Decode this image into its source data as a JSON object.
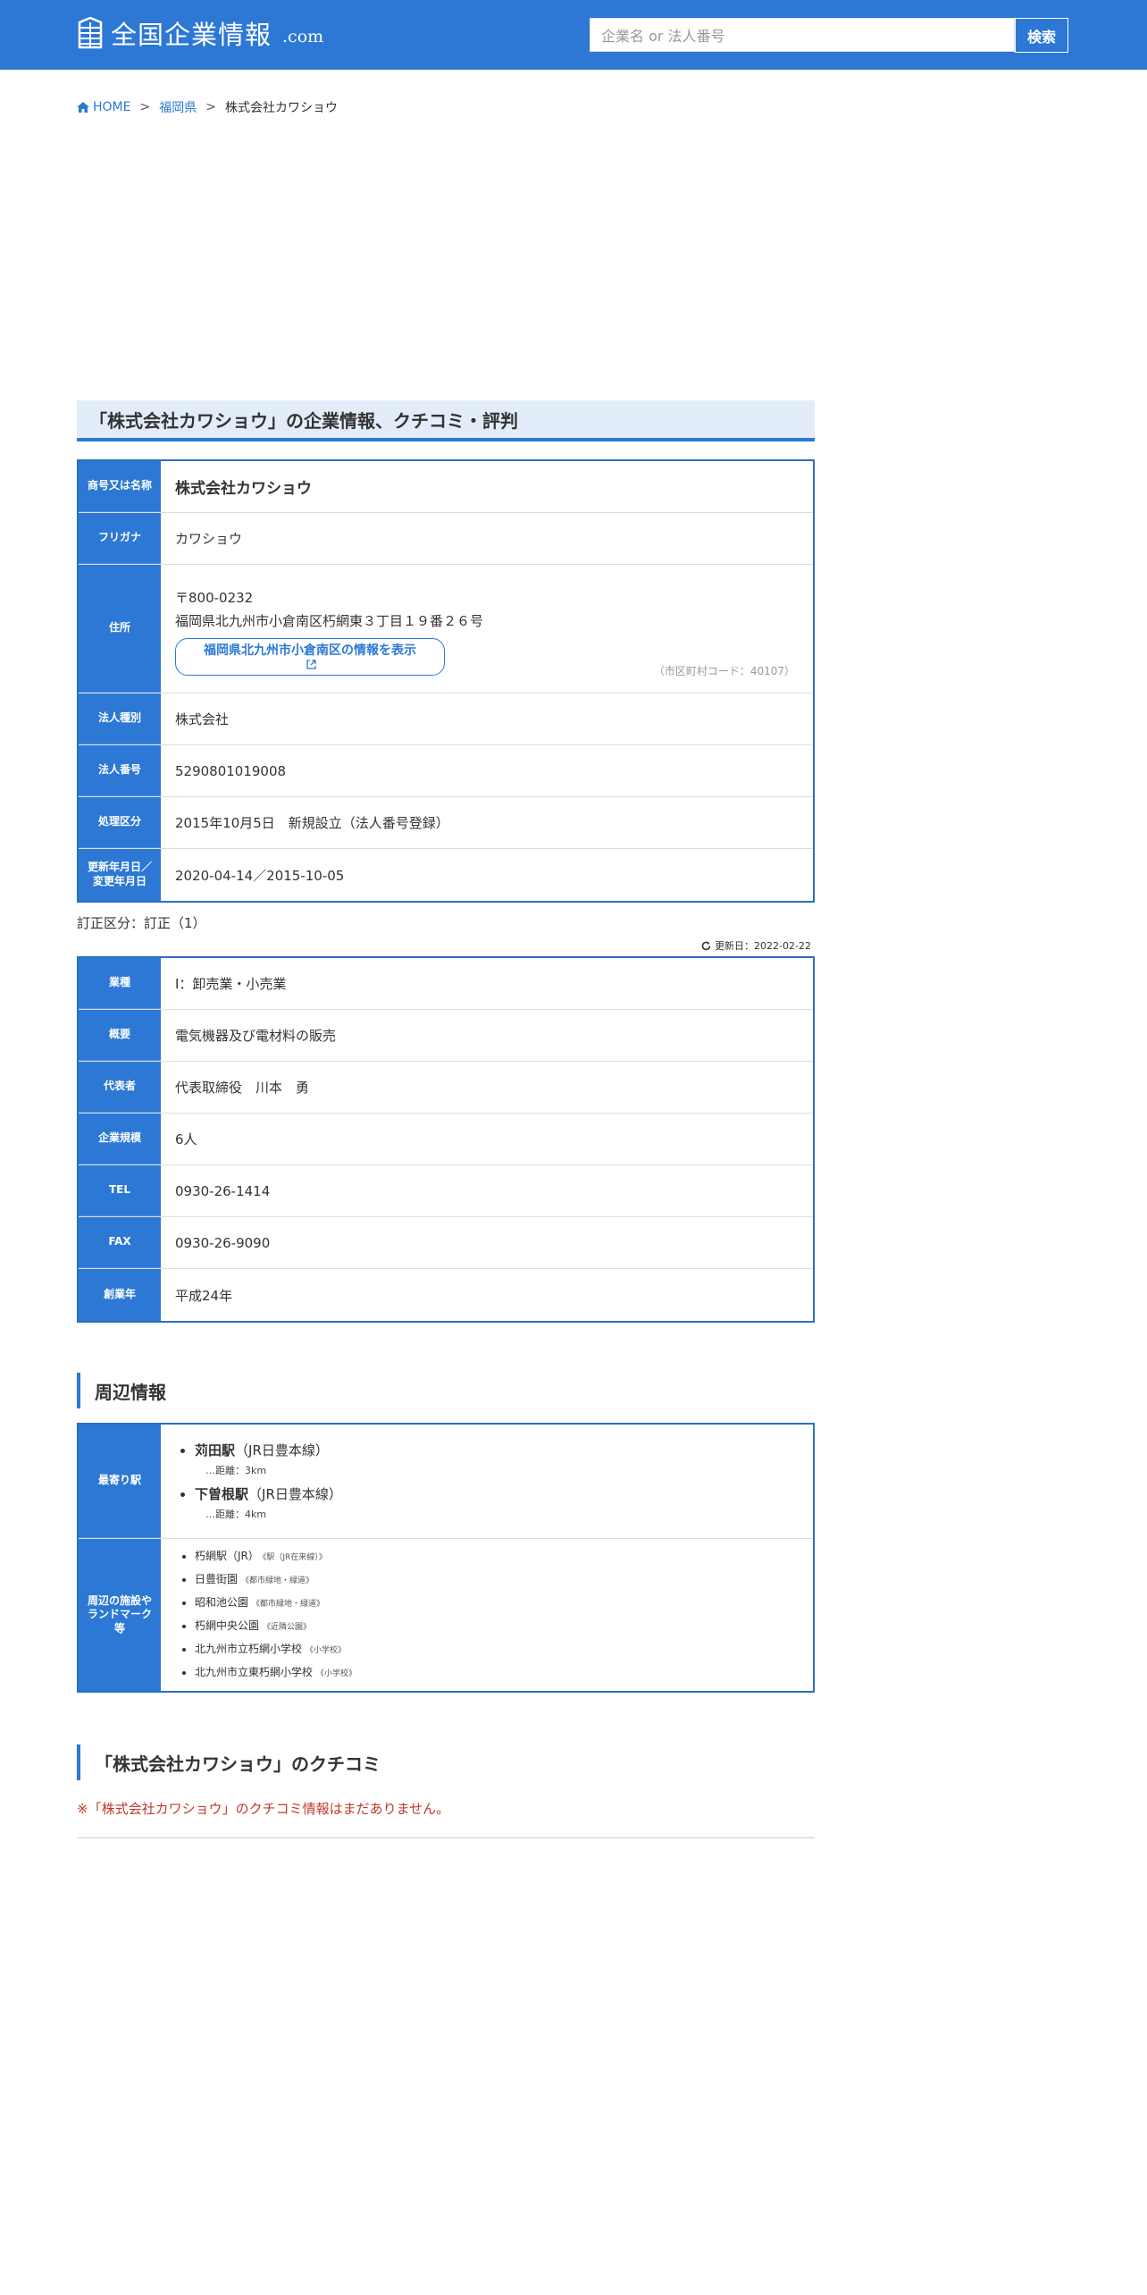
{
  "header": {
    "logo_text": "全国企業情報",
    "logo_suffix": ".com",
    "search_placeholder": "企業名 or 法人番号",
    "search_button": "検索"
  },
  "breadcrumb": {
    "home": "HOME",
    "prefecture": "福岡県",
    "current": "株式会社カワショウ"
  },
  "page_title": "「株式会社カワショウ」の企業情報、クチコミ・評判",
  "basic_info": {
    "name_label": "商号又は名称",
    "name_value": "株式会社カワショウ",
    "kana_label": "フリガナ",
    "kana_value": "カワショウ",
    "address_label": "住所",
    "postal": "〒800-0232",
    "address": "福岡県北九州市小倉南区朽網東３丁目１９番２６号",
    "area_link": "福岡県北九州市小倉南区の情報を表示",
    "city_code": "（市区町村コード：40107）",
    "type_label": "法人種別",
    "type_value": "株式会社",
    "number_label": "法人番号",
    "number_value": "5290801019008",
    "process_label": "処理区分",
    "process_value": "2015年10月5日　新規設立（法人番号登録）",
    "date_label_1": "更新年月日／",
    "date_label_2": "変更年月日",
    "date_value": "2020-04-14／2015-10-05"
  },
  "correction": "訂正区分：訂正（1）",
  "updated": "更新日：2022-02-22",
  "detail_info": {
    "industry_label": "業種",
    "industry_value": "I：卸売業・小売業",
    "summary_label": "概要",
    "summary_value": "電気機器及び電材料の販売",
    "rep_label": "代表者",
    "rep_value": "代表取締役　川本　勇",
    "scale_label": "企業規模",
    "scale_value": "6人",
    "tel_label": "TEL",
    "tel_value": "0930-26-1414",
    "fax_label": "FAX",
    "fax_value": "0930-26-9090",
    "founded_label": "創業年",
    "founded_value": "平成24年"
  },
  "nearby": {
    "heading": "周辺情報",
    "station_label": "最寄り駅",
    "stations": [
      {
        "name": "苅田駅",
        "line": "（JR日豊本線）",
        "distance": "…距離：3km"
      },
      {
        "name": "下曽根駅",
        "line": "（JR日豊本線）",
        "distance": "…距離：4km"
      }
    ],
    "landmark_label_1": "周辺の施設や",
    "landmark_label_2": "ランドマーク",
    "landmark_label_3": "等",
    "landmarks": [
      {
        "name": "朽網駅（JR）",
        "type": "《駅（JR在来線）》"
      },
      {
        "name": "日豊街園",
        "type": "《都市緑地・緑道》"
      },
      {
        "name": "昭和池公園",
        "type": "《都市緑地・緑道》"
      },
      {
        "name": "朽網中央公園",
        "type": "《近隣公園》"
      },
      {
        "name": "北九州市立朽網小学校",
        "type": "《小学校》"
      },
      {
        "name": "北九州市立東朽網小学校",
        "type": "《小学校》"
      }
    ]
  },
  "reviews": {
    "heading": "「株式会社カワショウ」のクチコミ",
    "empty": "※「株式会社カワショウ」のクチコミ情報はまだありません。"
  },
  "colors": {
    "primary": "#2c78d4",
    "title_bg": "#e3edf9",
    "alert": "#c0392b"
  }
}
